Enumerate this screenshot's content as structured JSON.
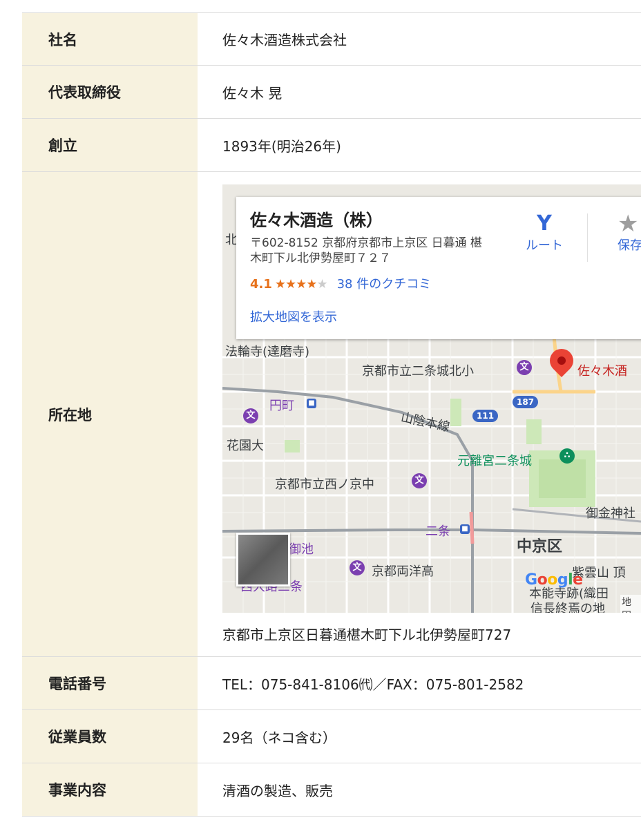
{
  "rows": {
    "company": {
      "label": "社名",
      "value": "佐々木酒造株式会社"
    },
    "ceo": {
      "label": "代表取締役",
      "value": "佐々木 晃"
    },
    "founded": {
      "label": "創立",
      "value": "1893年(明治26年)"
    },
    "location": {
      "label": "所在地",
      "address": "京都市上京区日暮通椹木町下ル北伊勢屋町727"
    },
    "phone": {
      "label": "電話番号",
      "value": "TEL：075-841-8106㈹／FAX：075-801-2582"
    },
    "employees": {
      "label": "従業員数",
      "value": "29名（ネコ含む）"
    },
    "business": {
      "label": "事業内容",
      "value": "清酒の製造、販売"
    }
  },
  "map": {
    "card": {
      "title": "佐々木酒造（株）",
      "address": "〒602-8152 京都府京都市上京区 日暮通 椹木町下ル北伊勢屋町７２７",
      "rating": "4.1",
      "stars_filled": "★★★★",
      "stars_empty": "★",
      "reviews": "38 件のクチコミ",
      "enlarge_link": "拡大地図を表示",
      "route_label": "ルート",
      "save_label": "保存"
    },
    "labels": {
      "temple": "法輪寺(達磨寺)",
      "school_north": "京都市立二条城北小",
      "sasaki_pin": "佐々木酒",
      "enmachi": "円町",
      "sanin": "山陰本線",
      "kaendai": "花園大",
      "nijojo": "元離宮二条城",
      "nishinokyo": "京都市立西ノ京中",
      "okane": "御金神社",
      "nijo": "二条",
      "nakagyo": "中京区",
      "oike": "御池",
      "yoyokou": "京都両洋高",
      "nishioji": "西大路三条",
      "shiunzan": "紫雲山 頂",
      "honnoji": "本能寺跡(織田",
      "nobunaga": "信長終焉の地",
      "route187": "187",
      "route111": "111",
      "edge_kita": "北",
      "mapdata": "地図"
    },
    "google": {
      "g": "G",
      "o1": "o",
      "o2": "o",
      "g2": "g",
      "l": "l",
      "e": "e"
    },
    "colors": {
      "pin": "#ea4335",
      "link": "#3367d6",
      "rating": "#e7711b",
      "park": "#cde8b8"
    }
  }
}
